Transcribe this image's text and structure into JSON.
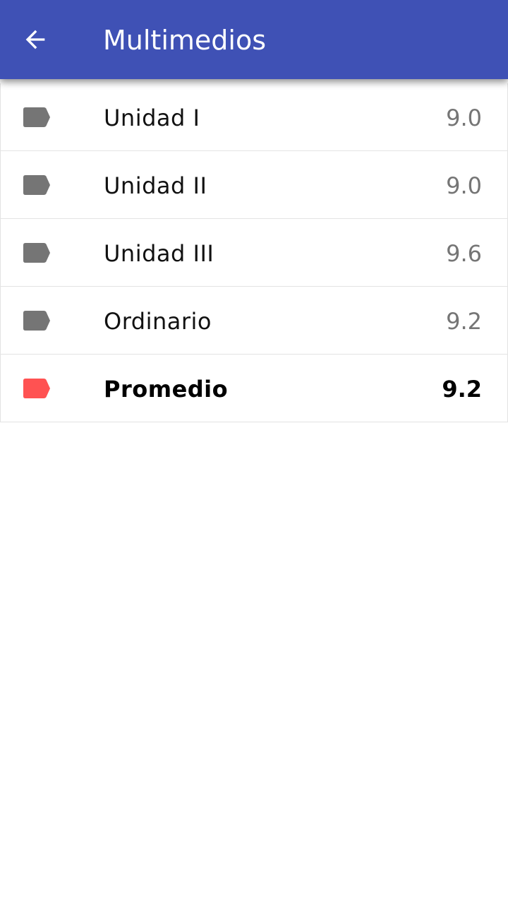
{
  "toolbar": {
    "title": "Multimedios",
    "back_icon": "arrow-left-icon",
    "background_color": "#3f51b5"
  },
  "grades": {
    "items": [
      {
        "label": "Unidad I",
        "value": "9.0",
        "icon": "label-tag-icon",
        "color": "#757575"
      },
      {
        "label": "Unidad II",
        "value": "9.0",
        "icon": "label-tag-icon",
        "color": "#757575"
      },
      {
        "label": "Unidad III",
        "value": "9.6",
        "icon": "label-tag-icon",
        "color": "#757575"
      },
      {
        "label": "Ordinario",
        "value": "9.2",
        "icon": "label-tag-icon",
        "color": "#757575"
      }
    ],
    "average": {
      "label": "Promedio",
      "value": "9.2",
      "icon": "label-tag-icon",
      "color": "#ff5252"
    }
  }
}
